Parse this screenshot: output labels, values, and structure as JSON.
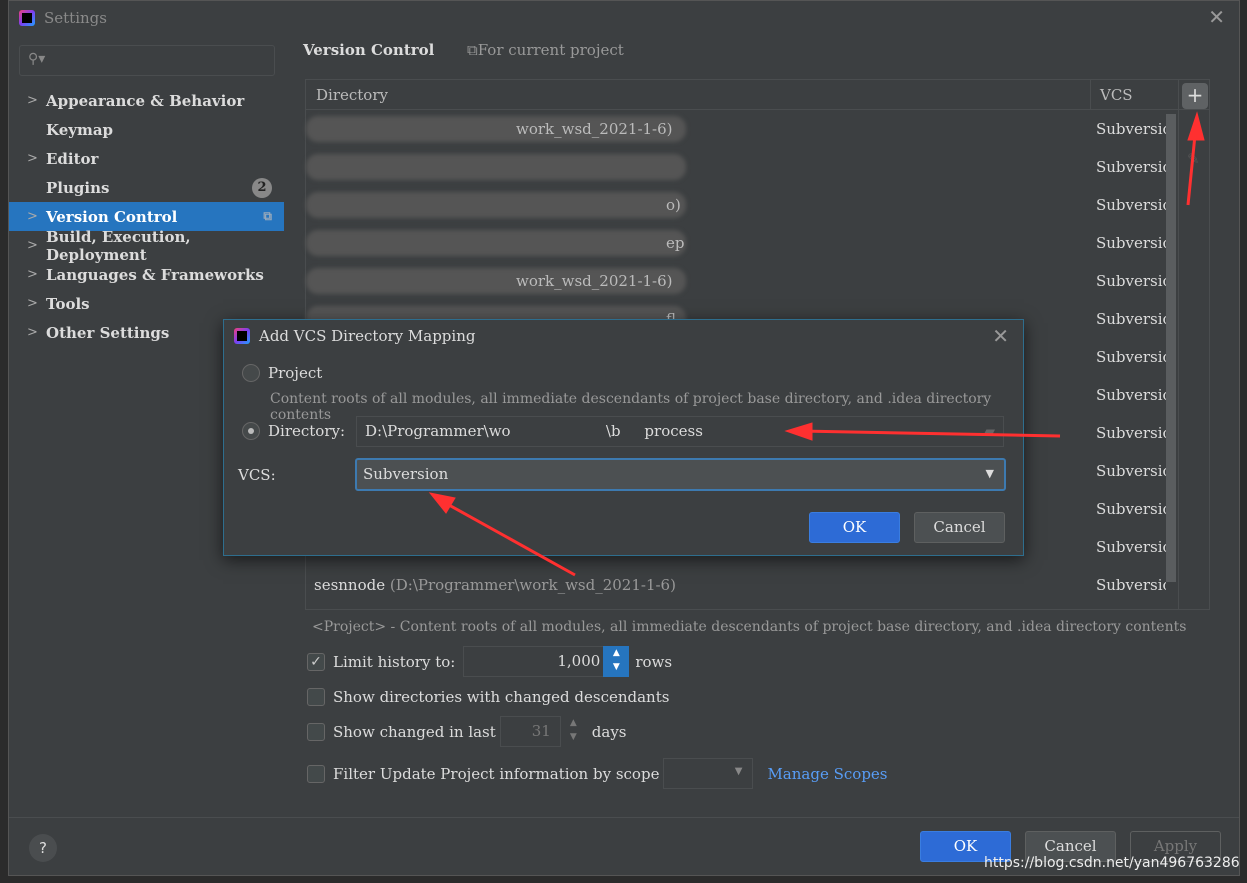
{
  "window": {
    "title": "Settings"
  },
  "search": {
    "placeholder": ""
  },
  "sidebar": {
    "items": [
      {
        "label": "Appearance & Behavior",
        "expandable": true
      },
      {
        "label": "Keymap",
        "expandable": false
      },
      {
        "label": "Editor",
        "expandable": true
      },
      {
        "label": "Plugins",
        "expandable": false,
        "badge": "2"
      },
      {
        "label": "Version Control",
        "expandable": true,
        "selected": true
      },
      {
        "label": "Build, Execution, Deployment",
        "expandable": true
      },
      {
        "label": "Languages & Frameworks",
        "expandable": true
      },
      {
        "label": "Tools",
        "expandable": true
      },
      {
        "label": "Other Settings",
        "expandable": true
      }
    ]
  },
  "main": {
    "title": "Version Control",
    "scope": "For current project",
    "table": {
      "headers": [
        "Directory",
        "VCS"
      ],
      "rows": [
        {
          "dir": "work_wsd_2021-1-6)",
          "vcs": "Subversion",
          "blurred": true
        },
        {
          "dir": "",
          "vcs": "Subversion",
          "blurred": true
        },
        {
          "dir": "o)",
          "vcs": "Subversion",
          "blurred": true
        },
        {
          "dir": "ep",
          "vcs": "Subversion",
          "blurred": true
        },
        {
          "dir": "work_wsd_2021-1-6)",
          "vcs": "Subversion",
          "blurred": true
        },
        {
          "dir": "fl",
          "vcs": "Subversion",
          "blurred": true
        },
        {
          "dir": "",
          "vcs": "Subversion"
        },
        {
          "dir": "",
          "vcs": "Subversion"
        },
        {
          "dir": "",
          "vcs": "Subversion"
        },
        {
          "dir": "",
          "vcs": "Subversion"
        },
        {
          "dir": "",
          "vcs": "Subversion"
        },
        {
          "dir": "",
          "vcs": "Subversion"
        },
        {
          "dir": "sesnnode",
          "path": "(D:\\Programmer\\work_wsd_2021-1-6)",
          "vcs": "Subversion"
        }
      ]
    },
    "note": "<Project> - Content roots of all modules, all immediate descendants of project base directory, and .idea directory contents",
    "limit_history": {
      "label": "Limit history to:",
      "checked": true,
      "value": "1,000",
      "suffix": "rows"
    },
    "show_dirs": {
      "label": "Show directories with changed descendants",
      "checked": false
    },
    "show_changed": {
      "label": "Show changed in last",
      "checked": false,
      "value": "31",
      "suffix": "days"
    },
    "filter": {
      "label": "Filter Update Project information by scope",
      "checked": false,
      "value": ""
    },
    "manage_scopes": "Manage Scopes"
  },
  "footer": {
    "ok": "OK",
    "cancel": "Cancel",
    "apply": "Apply",
    "help": "?"
  },
  "dialog": {
    "title": "Add VCS Directory Mapping",
    "project_label": "Project",
    "project_desc": "Content roots of all modules, all immediate descendants of project base directory, and .idea directory contents",
    "directory_label": "Directory:",
    "directory_value": "D:\\Programmer\\wo                    \\b     process",
    "vcs_label": "VCS:",
    "vcs_value": "Subversion",
    "ok": "OK",
    "cancel": "Cancel"
  },
  "watermark": "https://blog.csdn.net/yan496763286",
  "colors": {
    "accent": "#2675bf",
    "primary_button": "#2d6bd6",
    "link": "#589df6",
    "annotation": "#ff3030"
  }
}
